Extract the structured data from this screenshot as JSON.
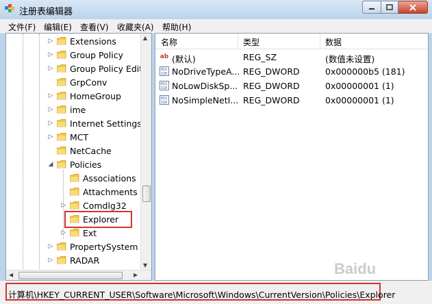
{
  "window": {
    "title": "注册表编辑器"
  },
  "menu": [
    {
      "label": "文件(F)"
    },
    {
      "label": "编辑(E)"
    },
    {
      "label": "查看(V)"
    },
    {
      "label": "收藏夹(A)"
    },
    {
      "label": "帮助(H)"
    }
  ],
  "tree": {
    "items": [
      {
        "label": "Extensions",
        "expander": "right"
      },
      {
        "label": "Group Policy",
        "expander": "right"
      },
      {
        "label": "Group Policy Edit",
        "expander": "right"
      },
      {
        "label": "GrpConv",
        "expander": "none"
      },
      {
        "label": "HomeGroup",
        "expander": "right"
      },
      {
        "label": "ime",
        "expander": "right"
      },
      {
        "label": "Internet Settings",
        "expander": "right"
      },
      {
        "label": "MCT",
        "expander": "right"
      },
      {
        "label": "NetCache",
        "expander": "none"
      },
      {
        "label": "Policies",
        "expander": "down"
      },
      {
        "label": "Associations",
        "expander": "none"
      },
      {
        "label": "Attachments",
        "expander": "none"
      },
      {
        "label": "Comdlg32",
        "expander": "right"
      },
      {
        "label": "Explorer",
        "expander": "none",
        "selected": true
      },
      {
        "label": "Ext",
        "expander": "right"
      },
      {
        "label": "PropertySystem",
        "expander": "right"
      },
      {
        "label": "RADAR",
        "expander": "right"
      }
    ]
  },
  "list": {
    "columns": [
      "名称",
      "类型",
      "数据"
    ],
    "rows": [
      {
        "icon": "string-value-icon",
        "name": "(默认)",
        "type": "REG_SZ",
        "data": "(数值未设置)"
      },
      {
        "icon": "binary-value-icon",
        "name": "NoDriveTypeA...",
        "type": "REG_DWORD",
        "data": "0x000000b5 (181)"
      },
      {
        "icon": "binary-value-icon",
        "name": "NoLowDiskSp...",
        "type": "REG_DWORD",
        "data": "0x00000001 (1)"
      },
      {
        "icon": "binary-value-icon",
        "name": "NoSimpleNetI...",
        "type": "REG_DWORD",
        "data": "0x00000001 (1)"
      }
    ]
  },
  "status": {
    "path": "计算机\\HKEY_CURRENT_USER\\Software\\Microsoft\\Windows\\CurrentVersion\\Policies\\Explorer"
  },
  "watermark": "Baidu",
  "colors": {
    "highlight": "#d0342c",
    "folder": "#f1c84b"
  }
}
